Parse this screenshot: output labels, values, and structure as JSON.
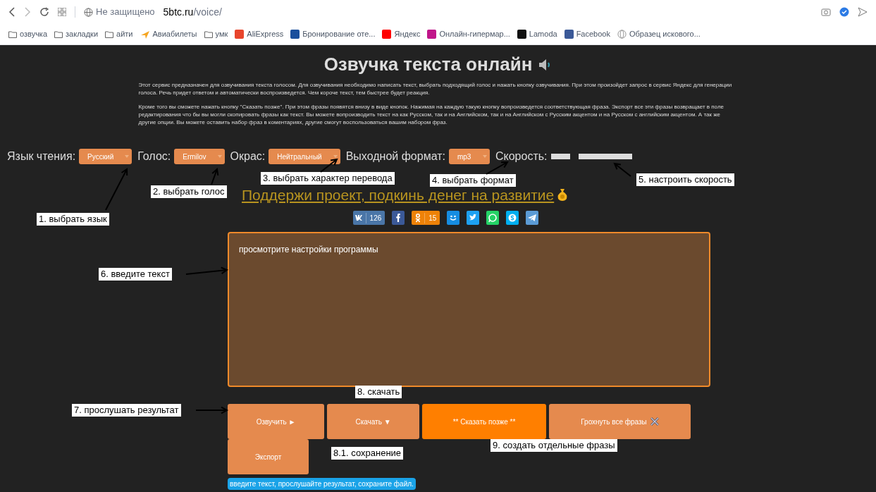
{
  "browser": {
    "security": "Не защищено",
    "url_host": "5btc.ru",
    "url_path": "/voice/",
    "bookmarks": [
      {
        "label": "озвучка",
        "kind": "folder"
      },
      {
        "label": "закладки",
        "kind": "folder"
      },
      {
        "label": "айти",
        "kind": "folder"
      },
      {
        "label": "Авиабилеты",
        "kind": "plane",
        "color": "#f5a623"
      },
      {
        "label": "умк",
        "kind": "folder"
      },
      {
        "label": "AliExpress",
        "kind": "square",
        "color": "#e8452c"
      },
      {
        "label": "Бронирование оте...",
        "kind": "square",
        "color": "#1a4f9c"
      },
      {
        "label": "Яндекс",
        "kind": "square",
        "color": "#ff0000"
      },
      {
        "label": "Онлайн-гипермар...",
        "kind": "square",
        "color": "#c0168a"
      },
      {
        "label": "Lamoda",
        "kind": "square",
        "color": "#111111"
      },
      {
        "label": "Facebook",
        "kind": "square",
        "color": "#3b5998"
      },
      {
        "label": "Образец искового...",
        "kind": "globe"
      }
    ]
  },
  "page": {
    "title": "Озвучка текста онлайн",
    "description": [
      "Этот сервис предназначен для озвучивания текста голосом. Для озвучивания необходимо написать текст, выбрать подходящий голос и нажать кнопку озвучивания. При этом произойдет запрос в сервис Яндекс для генерации голоса. Речь придет ответом и автоматически воспроизведется. Чем короче текст, тем быстрее будет реакция.",
      "Кроме того вы сможете нажать кнопку \"Сказать позже\". При этом фразы появятся внизу в виде кнопок. Нажимая на каждую такую кнопку вопроизведется соответствующая фраза. Экспорт все эти фразы возвращает в поле редактирования что бы вы могли скопировать фразы как текст. Вы можете вопроизводить текст на как Русском, так и на Английском, так и на Английском с Русским акцентом и на Русском с английским акцентом. А так же другие опции. Вы можете оставить набор фраз в коментариях, другие смогут воспользоваться вашим набором фраз."
    ],
    "controls": [
      {
        "kind": "select",
        "label": "Язык чтения:",
        "value": "Русский"
      },
      {
        "kind": "select",
        "label": "Голос:",
        "value": "Ermilov"
      },
      {
        "kind": "select",
        "label": "Окрас:",
        "value": "Нейтральный"
      },
      {
        "kind": "select",
        "label": "Выходной формат:",
        "value": "mp3"
      },
      {
        "kind": "speed",
        "label": "Скорость:",
        "level": 0.27
      }
    ],
    "donate": "Поддержи проект, подкинь денег на развитие",
    "social": [
      {
        "kind": "vk",
        "count": "126",
        "color": "#4a76a8"
      },
      {
        "kind": "facebook",
        "color": "#3b5998"
      },
      {
        "kind": "odnoklassniki",
        "count": "15",
        "color": "#ee8208"
      },
      {
        "kind": "moimir",
        "color": "#168de2"
      },
      {
        "kind": "twitter",
        "color": "#1da1f2"
      },
      {
        "kind": "whatsapp",
        "color": "#25d366"
      },
      {
        "kind": "skype",
        "color": "#00aff0"
      },
      {
        "kind": "telegram",
        "color": "#5b9bd5"
      }
    ],
    "text_value": "просмотрите настройки программы",
    "buttons": [
      {
        "label": "Озвучить ►",
        "kind": "normal"
      },
      {
        "label": "Скачать ▼",
        "kind": "normal"
      },
      {
        "label": "** Сказать позже **",
        "kind": "accent"
      },
      {
        "label": "Грохнуть все фразы",
        "kind": "clear"
      },
      {
        "label": "Экспорт",
        "kind": "normal"
      }
    ],
    "hint": "введите текст, прослушайте результат, сохраните файл."
  },
  "annotations": [
    "1. выбрать язык",
    "2. выбрать голос",
    "3. выбрать характер перевода",
    "4. выбрать формат",
    "5. настроить скорость",
    "6. введите текст",
    "7. прослушать результат",
    "8. скачать",
    "8.1. сохранение",
    "9. создать отдельные фразы"
  ]
}
